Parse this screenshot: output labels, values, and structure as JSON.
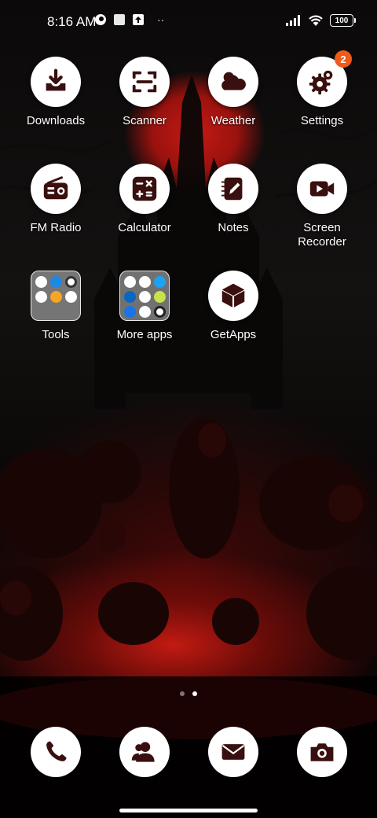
{
  "status_bar": {
    "time": "8:16 AM",
    "battery": "100",
    "notification_icons": [
      "app-notification-icon",
      "square-icon",
      "upload-icon"
    ],
    "more": "··"
  },
  "apps": {
    "downloads": {
      "label": "Downloads",
      "icon": "download-icon"
    },
    "scanner": {
      "label": "Scanner",
      "icon": "scan-icon"
    },
    "weather": {
      "label": "Weather",
      "icon": "cloud-icon"
    },
    "settings": {
      "label": "Settings",
      "icon": "gear-icon",
      "badge": "2"
    },
    "fm_radio": {
      "label": "FM Radio",
      "icon": "radio-icon"
    },
    "calculator": {
      "label": "Calculator",
      "icon": "calculator-icon"
    },
    "notes": {
      "label": "Notes",
      "icon": "notes-icon"
    },
    "screen_recorder": {
      "label": "Screen Recorder",
      "icon": "video-camera-icon"
    },
    "tools": {
      "label": "Tools",
      "icon": "folder-icon"
    },
    "more_apps": {
      "label": "More apps",
      "icon": "folder-icon"
    },
    "getapps": {
      "label": "GetApps",
      "icon": "box-icon"
    }
  },
  "dock": [
    "phone-icon",
    "contacts-icon",
    "mail-icon",
    "camera-icon"
  ],
  "page_indicator": {
    "pages": 2,
    "current": 2
  },
  "colors": {
    "accent_badge": "#f05a1a",
    "icon_bg": "#ffffff",
    "icon_fg": "#3a0f0f"
  }
}
